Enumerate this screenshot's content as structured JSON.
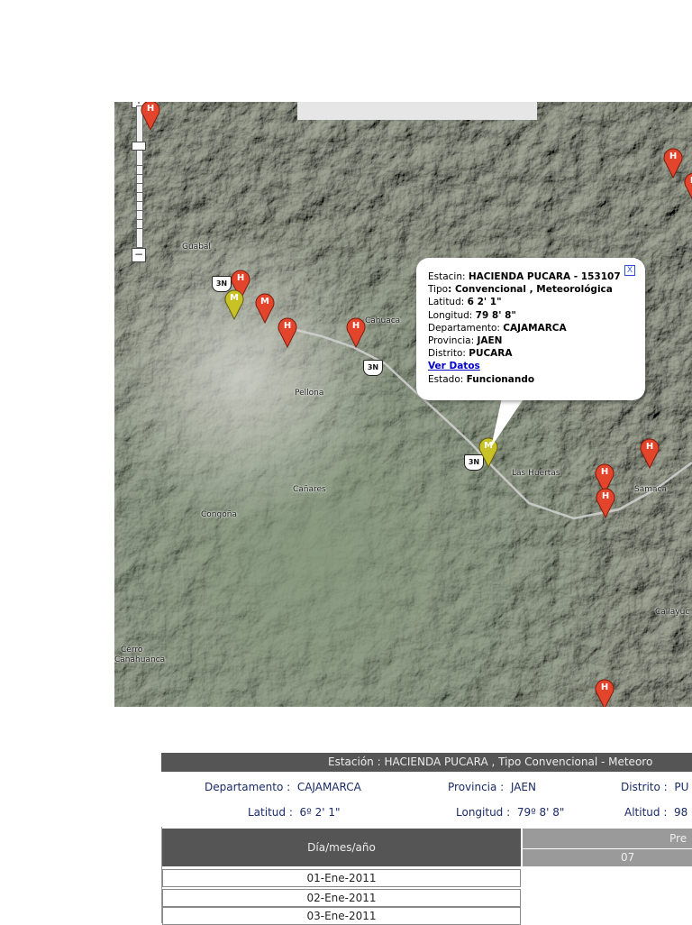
{
  "map": {
    "zoom_in_label": "+",
    "zoom_out_label": "−",
    "places": [
      "Guabal",
      "Pellona",
      "Cañares",
      "Congoña",
      "Cerro",
      "Canahuanca",
      "Las Huertas",
      "Samaca",
      "Callayuc",
      "Cahuaca"
    ],
    "road_shield": "3N",
    "marker_letters": {
      "h": "H",
      "m": "M"
    },
    "marker_colors": {
      "h": "#e2452b",
      "m": "#c9c226"
    }
  },
  "popup": {
    "close_label": "X",
    "station_label": "Estacin:",
    "station_value": "HACIENDA PUCARA - 153107",
    "tipo_label": "Tipo",
    "tipo_value": ": Convencional , Meteorológica",
    "latitud_label": "Latitud:",
    "latitud_value": "6 2' 1\"",
    "longitud_label": "Longitud:",
    "longitud_value": "79 8' 8\"",
    "departamento_label": "Departamento:",
    "departamento_value": "CAJAMARCA",
    "provincia_label": "Provincia:",
    "provincia_value": "JAEN",
    "distrito_label": "Distrito:",
    "distrito_value": "PUCARA",
    "link_label": "Ver Datos",
    "estado_label": "Estado:",
    "estado_value": "Funcionando"
  },
  "table": {
    "header": "Estación : HACIENDA PUCARA , Tipo Convencional - Meteoro",
    "departamento_label": "Departamento :",
    "departamento_value": "CAJAMARCA",
    "provincia_label": "Provincia :",
    "provincia_value": "JAEN",
    "distrito_label": "Distrito :",
    "distrito_value": "PU",
    "latitud_label": "Latitud :",
    "latitud_value": "6º 2' 1\"",
    "longitud_label": "Longitud :",
    "longitud_value": "79º 8' 8\"",
    "altitud_label": "Altitud :",
    "altitud_value": "98",
    "date_col_header": "Día/mes/año",
    "precip_header": "Pre",
    "precip_sub": "07",
    "rows": [
      "01-Ene-2011",
      "02-Ene-2011",
      "03-Ene-2011"
    ]
  }
}
